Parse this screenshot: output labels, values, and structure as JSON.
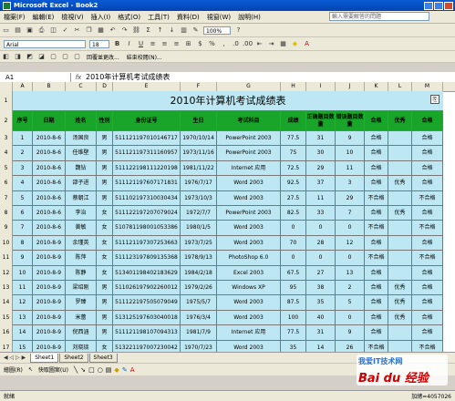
{
  "window": {
    "title": "Microsoft Excel - Book2"
  },
  "menu": [
    "檔案(F)",
    "編輯(E)",
    "檢視(V)",
    "插入(I)",
    "格式(O)",
    "工具(T)",
    "資料(D)",
    "視窗(W)",
    "說明(H)"
  ],
  "ask_placeholder": "輸入需要解答的問題",
  "toolbar": {
    "font": "Arial",
    "size": "18",
    "zoom": "100%"
  },
  "toolbar3": {
    "reply": "回覆並更改...",
    "end_review": "結束校閱(N)..."
  },
  "namebox": "A1",
  "formula": "2010年计算机考试成绩表",
  "columns": [
    "A",
    "B",
    "C",
    "D",
    "E",
    "F",
    "G",
    "H",
    "I",
    "J",
    "K",
    "L",
    "M"
  ],
  "sheet_title": "2010年计算机考试成绩表",
  "table_headers": [
    "序号",
    "日期",
    "姓名",
    "性别",
    "身份证号",
    "生日",
    "考试科目",
    "成绩",
    "正确题目数量",
    "错误题目数量",
    "合格",
    "优秀",
    "合格"
  ],
  "rows": [
    [
      "1",
      "2010-8-6",
      "汤国良",
      "男",
      "511121197010146717",
      "1970/10/14",
      "PowerPoint 2003",
      "77.5",
      "31",
      "9",
      "合格",
      "",
      "合格"
    ],
    [
      "2",
      "2010-8-6",
      "任维壁",
      "男",
      "511121197311160957",
      "1973/11/16",
      "PowerPoint 2003",
      "75",
      "30",
      "10",
      "合格",
      "",
      "合格"
    ],
    [
      "3",
      "2010-8-6",
      "魏钻",
      "男",
      "511122198111220198",
      "1981/11/22",
      "Internet 应用",
      "72.5",
      "29",
      "11",
      "合格",
      "",
      "合格"
    ],
    [
      "4",
      "2010-8-6",
      "邵子进",
      "男",
      "511121197607171831",
      "1976/7/17",
      "Word 2003",
      "92.5",
      "37",
      "3",
      "合格",
      "优秀",
      "合格"
    ],
    [
      "5",
      "2010-8-6",
      "蔡朝江",
      "男",
      "511102197310030434",
      "1973/10/3",
      "Word 2003",
      "27.5",
      "11",
      "29",
      "不合格",
      "",
      "不合格"
    ],
    [
      "6",
      "2010-8-6",
      "李治",
      "女",
      "511122197207079024",
      "1972/7/7",
      "PowerPoint 2003",
      "82.5",
      "33",
      "7",
      "合格",
      "优秀",
      "合格"
    ],
    [
      "7",
      "2010-8-6",
      "黄敏",
      "女",
      "510781198001053386",
      "1980/1/5",
      "Word 2003",
      "0",
      "0",
      "0",
      "不合格",
      "",
      "不合格"
    ],
    [
      "8",
      "2010-8-9",
      "余瑾英",
      "女",
      "511121197307253663",
      "1973/7/25",
      "Word 2003",
      "70",
      "28",
      "12",
      "合格",
      "",
      "合格"
    ],
    [
      "9",
      "2010-8-9",
      "陈萍",
      "女",
      "511123197809135368",
      "1978/9/13",
      "PhotoShop 6.0",
      "0",
      "0",
      "0",
      "不合格",
      "",
      "不合格"
    ],
    [
      "10",
      "2010-8-9",
      "陈静",
      "女",
      "513401198402183629",
      "1984/2/18",
      "Excel 2003",
      "67.5",
      "27",
      "13",
      "合格",
      "",
      "合格"
    ],
    [
      "11",
      "2010-8-9",
      "梁绍刚",
      "男",
      "511026197902260012",
      "1979/2/26",
      "Windows XP",
      "95",
      "38",
      "2",
      "合格",
      "优秀",
      "合格"
    ],
    [
      "12",
      "2010-8-9",
      "罗臻",
      "男",
      "511122197505079049",
      "1975/5/7",
      "Word 2003",
      "87.5",
      "35",
      "5",
      "合格",
      "优秀",
      "合格"
    ],
    [
      "13",
      "2010-8-9",
      "米蕾",
      "男",
      "513125197603040018",
      "1976/3/4",
      "Word 2003",
      "100",
      "40",
      "0",
      "合格",
      "优秀",
      "合格"
    ],
    [
      "14",
      "2010-8-9",
      "倪西涵",
      "男",
      "511121198107094313",
      "1981/7/9",
      "Internet 应用",
      "77.5",
      "31",
      "9",
      "合格",
      "",
      "合格"
    ],
    [
      "15",
      "2010-8-9",
      "刘晓琰",
      "女",
      "513221197007230042",
      "1970/7/23",
      "Word 2003",
      "35",
      "14",
      "26",
      "不合格",
      "",
      "不合格"
    ]
  ],
  "sheet_tabs": [
    "Sheet1",
    "Sheet2",
    "Sheet3"
  ],
  "drawbar": {
    "draw": "繪圖(R)",
    "autoshapes": "快取圖案(U)"
  },
  "status": {
    "left": "就緒",
    "right": "加總=4057026"
  },
  "watermark": {
    "text": "Bai du 经验",
    "site": "我爱IT技术网"
  },
  "colors": {
    "header_green": "#19a52a",
    "body_blue": "#bde8f3",
    "title_bar": "#0a5bd6"
  }
}
